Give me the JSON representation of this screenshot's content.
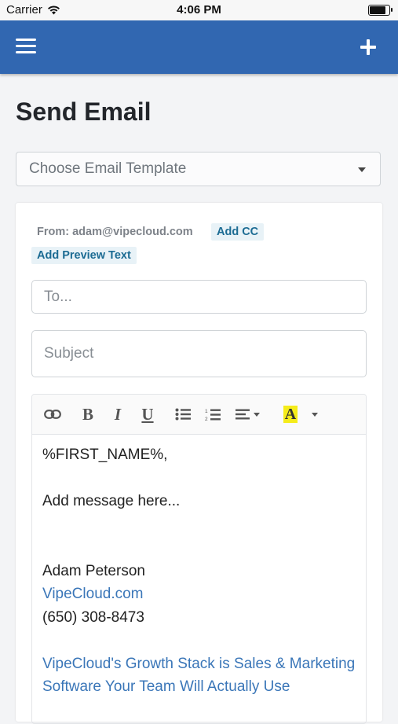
{
  "status_bar": {
    "carrier": "Carrier",
    "time": "4:06 PM"
  },
  "nav_bar": {
    "menu_icon": "hamburger-icon",
    "add_icon": "plus-icon",
    "background": "#3167b1"
  },
  "page": {
    "title": "Send Email"
  },
  "template_select": {
    "placeholder": "Choose Email Template"
  },
  "email_form": {
    "from_text": "From: adam@vipecloud.com",
    "add_cc_label": "Add CC",
    "add_preview_label": "Add Preview Text",
    "to_placeholder": "To...",
    "subject_placeholder": "Subject"
  },
  "toolbar": {
    "buttons": [
      "link-icon",
      "bold-icon",
      "italic-icon",
      "underline-icon",
      "bullet-list-icon",
      "numbered-list-icon",
      "align-icon",
      "highlight-color-icon"
    ],
    "bold_glyph": "B",
    "italic_glyph": "I",
    "underline_glyph": "U",
    "highlight_glyph": "A",
    "highlight_color": "#f5ec1a"
  },
  "editor": {
    "greeting": "%FIRST_NAME%,",
    "message": "Add message here...",
    "signature_name": "Adam Peterson",
    "signature_link": "VipeCloud.com",
    "signature_phone": "(650) 308-8473",
    "footer_link": "VipeCloud's Growth Stack is Sales & Marketing Software Your Team Will Actually Use",
    "link_color": "#3a76b8"
  }
}
